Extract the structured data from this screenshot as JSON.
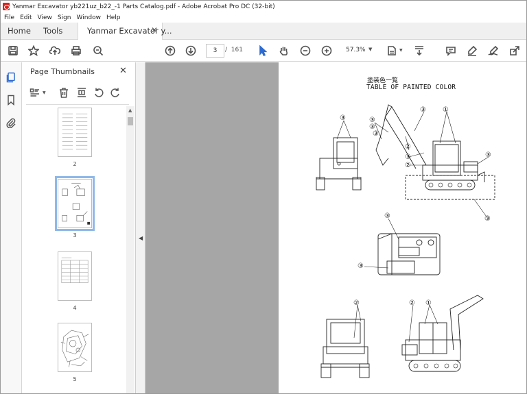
{
  "window": {
    "title": "Yanmar Excavator yb221uz_b22_-1 Parts Catalog.pdf - Adobe Acrobat Pro DC (32-bit)"
  },
  "menu": [
    "File",
    "Edit",
    "View",
    "Sign",
    "Window",
    "Help"
  ],
  "tabs": {
    "home": "Home",
    "tools": "Tools",
    "document": "Yanmar Excavator y...",
    "close": "✕"
  },
  "toolbar": {
    "current_page": "3",
    "page_separator": "/",
    "total_pages": "161",
    "zoom": "57.3%",
    "icons": [
      "save-icon",
      "bookmark-star-icon",
      "upload-icon",
      "print-icon",
      "zoom-search-icon",
      "prev-page-icon",
      "next-page-icon",
      "select-cursor-icon",
      "hand-icon",
      "zoom-out-icon",
      "zoom-in-icon",
      "page-fit-icon",
      "scroll-mode-icon",
      "comment-icon",
      "highlight-icon",
      "sign-icon",
      "share-icon"
    ]
  },
  "left_rail": {
    "icons": [
      "page-thumbnails-icon",
      "bookmarks-icon",
      "attachments-icon"
    ]
  },
  "thumbnails_panel": {
    "title": "Page Thumbnails",
    "close": "✕",
    "thumbnails": [
      {
        "number": "2",
        "selected": false
      },
      {
        "number": "3",
        "selected": true
      },
      {
        "number": "4",
        "selected": false
      },
      {
        "number": "5",
        "selected": false
      }
    ]
  },
  "document": {
    "title_jp": "塗装色一覧",
    "title_en": "TABLE OF PAINTED COLOR",
    "callouts": [
      "①",
      "②",
      "③"
    ]
  },
  "colors": {
    "accent_red": "#d9231d",
    "selection_blue": "#8fb8e8",
    "doc_gray": "#a6a6a6"
  }
}
